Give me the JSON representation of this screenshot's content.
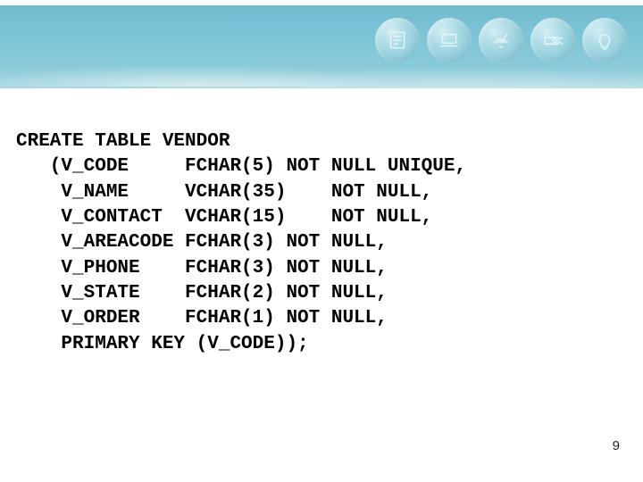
{
  "slide": {
    "banner_icons": [
      "notebook-icon",
      "laptop-icon",
      "satellite-dish-icon",
      "projector-icon",
      "lightbulb-icon"
    ],
    "code": {
      "line1": "CREATE TABLE VENDOR",
      "line2": "   (V_CODE     FCHAR(5) NOT NULL UNIQUE,",
      "line3": "    V_NAME     VCHAR(35)    NOT NULL,",
      "line4": "    V_CONTACT  VCHAR(15)    NOT NULL,",
      "line5": "    V_AREACODE FCHAR(3) NOT NULL,",
      "line6": "    V_PHONE    FCHAR(3) NOT NULL,",
      "line7": "    V_STATE    FCHAR(2) NOT NULL,",
      "line8": "    V_ORDER    FCHAR(1) NOT NULL,",
      "line9": "    PRIMARY KEY (V_CODE));"
    },
    "page_number": "9"
  }
}
